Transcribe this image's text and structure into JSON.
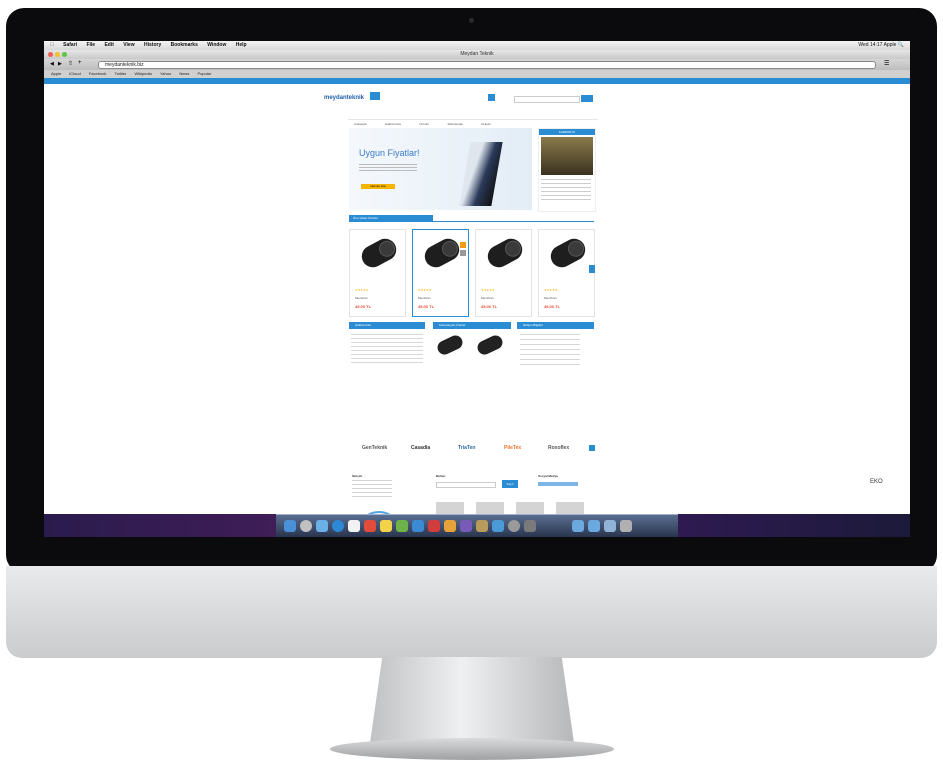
{
  "mac_menubar": {
    "items": [
      "Safari",
      "File",
      "Edit",
      "View",
      "History",
      "Bookmarks",
      "Window",
      "Help"
    ],
    "clock": "Wed 14:17",
    "user": "Apple"
  },
  "browser": {
    "window_title": "Meydan Teknik",
    "url": "meydanteknik.biz",
    "bookmarks": [
      "Apple",
      "iCloud",
      "Facebook",
      "Twitter",
      "Wikipedia",
      "Yahoo",
      "News",
      "Popular"
    ]
  },
  "site": {
    "logo": "meydanteknik",
    "nav": [
      "Anasayfa",
      "Hakkımızda",
      "Ürünler",
      "Referanslar",
      "İletişim"
    ],
    "hero": {
      "title": "Uygun Fiyatlar!",
      "button": "Hemen Ara"
    },
    "side_banner_title": "KAMPANYA",
    "section_title": "Öne Çıkan Ürünler",
    "products": [
      {
        "name": "Membran",
        "price": "45.00 TL"
      },
      {
        "name": "Membran",
        "price": "45.00 TL"
      },
      {
        "name": "Membran",
        "price": "45.00 TL"
      },
      {
        "name": "Membran",
        "price": "45.00 TL"
      }
    ],
    "info_boxes": [
      "Hakkımızda",
      "Kampanyalı Ürünler",
      "İletişim Bilgileri"
    ],
    "brands": [
      "GenTeknik",
      "Casadia",
      "TriaTen",
      "PileTex",
      "Roxoflex"
    ],
    "footer": {
      "columns": [
        "İletişim",
        "Bülten",
        "Sosyal Medya"
      ],
      "newsletter_button": "Kayıt"
    }
  },
  "monitor_label": "EKO",
  "colors": {
    "accent": "#2a8dd4",
    "price": "#e84a2f",
    "hero_button": "#f5b400"
  }
}
